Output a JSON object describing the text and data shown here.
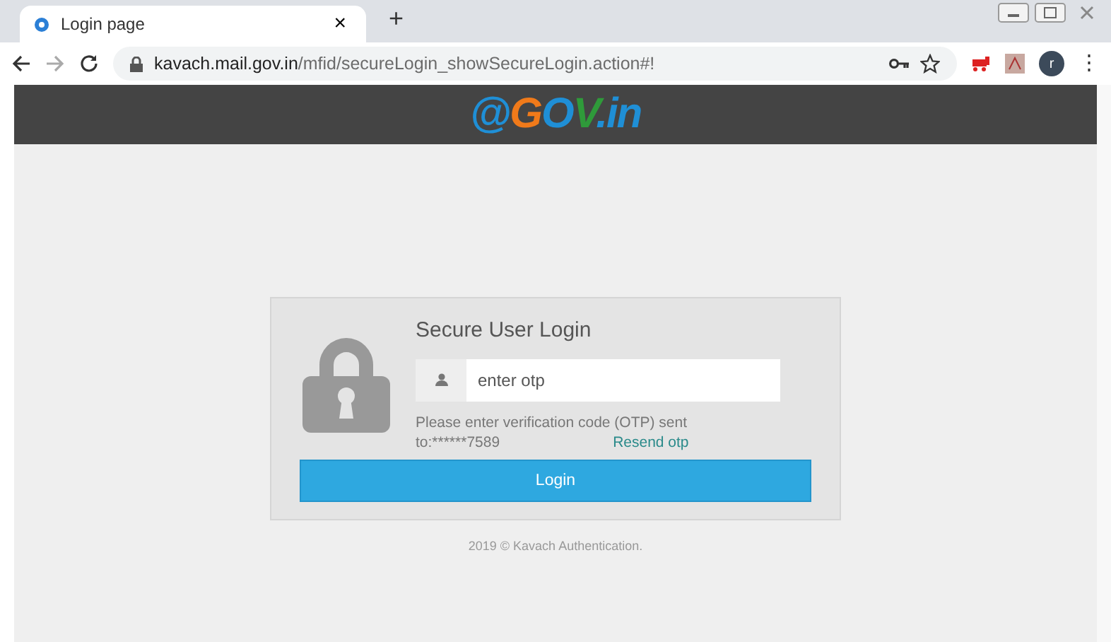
{
  "browser": {
    "tab": {
      "title": "Login page",
      "close": "×",
      "selected": true
    },
    "new_tab": "+",
    "url_host": "kavach.mail.gov.in",
    "url_path": "/mfid/secureLogin_showSecureLogin.action#!",
    "profile": "r",
    "menu": "⋮"
  },
  "header": {
    "logo": [
      {
        "text": "@",
        "color": "#1f8fd6"
      },
      {
        "text": "G",
        "color": "#f07a1a"
      },
      {
        "text": "O",
        "color": "#1f8fd6"
      },
      {
        "text": "V",
        "color": "#2f9a3a"
      },
      {
        "text": ".in",
        "color": "#1f8fd6"
      }
    ]
  },
  "login": {
    "title": "Secure User Login",
    "otp_field": {
      "placeholder": "enter otp"
    },
    "message": [
      "Please enter verification code (OTP) sent",
      "to:******7589"
    ],
    "resend": "Resend otp",
    "button": "Login"
  },
  "footer": "2019 © Kavach Authentication."
}
